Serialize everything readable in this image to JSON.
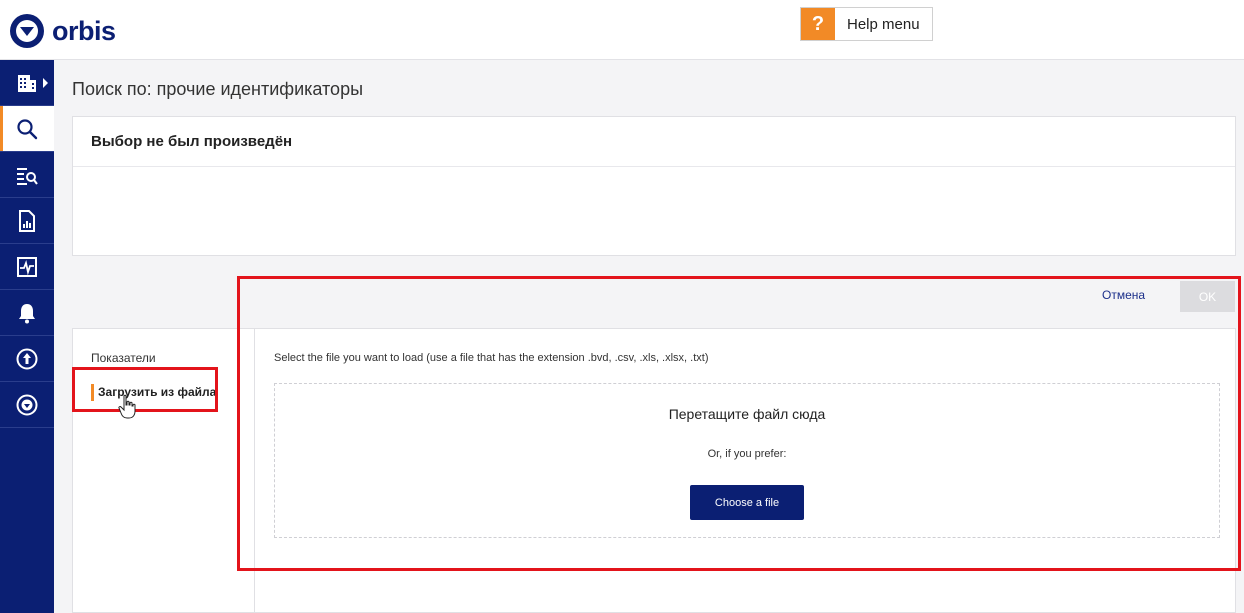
{
  "app": {
    "logo_text": "orbis"
  },
  "help": {
    "icon_text": "?",
    "label": "Help menu"
  },
  "sidebar": {
    "items": [
      {
        "icon": "building-icon",
        "has_submenu": true
      },
      {
        "icon": "search-icon",
        "active": true
      },
      {
        "icon": "list-search-icon"
      },
      {
        "icon": "report-icon"
      },
      {
        "icon": "activity-icon"
      },
      {
        "icon": "bell-icon"
      },
      {
        "icon": "upload-circle-icon"
      },
      {
        "icon": "orbis-circle-icon"
      }
    ]
  },
  "page": {
    "title": "Поиск по: прочие идентификаторы",
    "selection_heading": "Выбор не был произведён"
  },
  "actions": {
    "cancel": "Отмена",
    "ok": "OK"
  },
  "left_menu": {
    "items": [
      {
        "label": "Показатели",
        "selected": false
      },
      {
        "label": "Загрузить из файла",
        "selected": true
      }
    ]
  },
  "upload": {
    "instruction": "Select the file you want to load (use a file that has the extension .bvd, .csv, .xls, .xlsx, .txt)",
    "drop_title": "Перетащите файл сюда",
    "or_text": "Or, if you prefer:",
    "choose_button": "Choose a file"
  },
  "colors": {
    "navy": "#0b1f73",
    "accent_orange": "#f28a26",
    "highlight_red": "#e3141b"
  }
}
